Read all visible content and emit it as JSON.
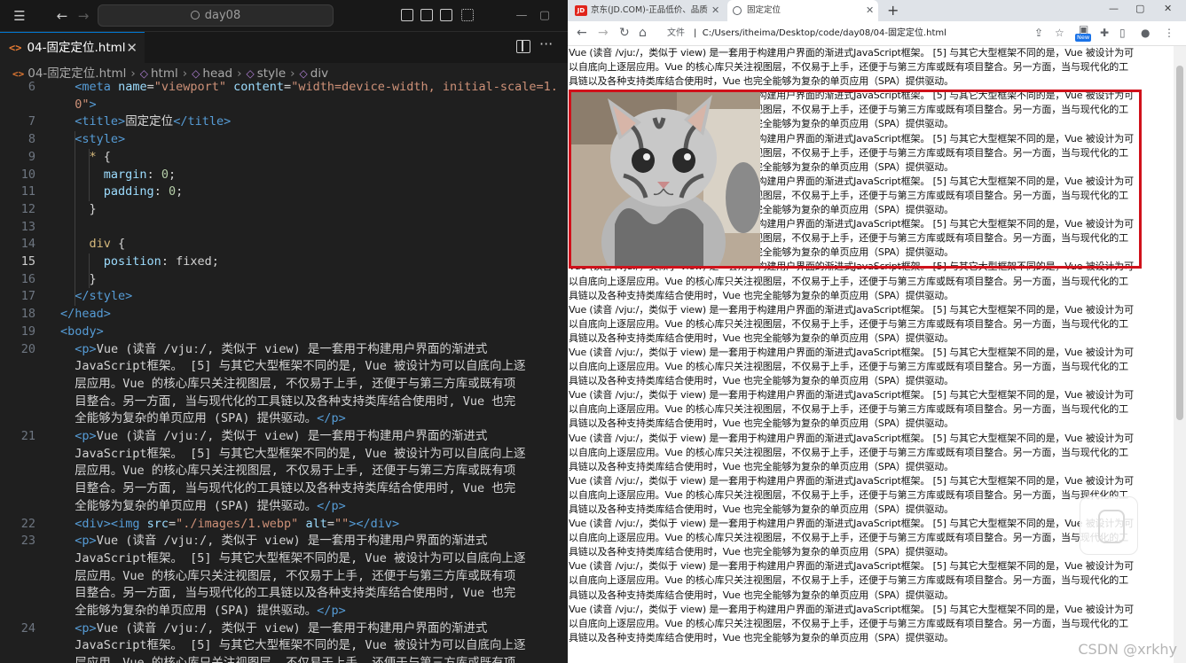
{
  "editor": {
    "search": "day08",
    "tab": {
      "title": "04-固定定位.html",
      "icon": "html-file-icon"
    },
    "breadcrumb": [
      "04-固定定位.html",
      "html",
      "head",
      "style",
      "div"
    ],
    "code_lines": [
      {
        "n": "6",
        "html": "  <span class=\"tag\">&lt;</span><span class=\"tagname\">meta</span> <span class=\"attr\">name</span>=<span class=\"str\">\"viewport\"</span> <span class=\"attr\">content</span>=<span class=\"str\">\"width=device-width, initial-scale=1.</span>"
      },
      {
        "n": "",
        "html": "  <span class=\"str\">0\"</span><span class=\"tag\">&gt;</span>"
      },
      {
        "n": "7",
        "html": "  <span class=\"tag\">&lt;</span><span class=\"tagname\">title</span><span class=\"tag\">&gt;</span><span class=\"txt\">固定定位</span><span class=\"tag\">&lt;/</span><span class=\"tagname\">title</span><span class=\"tag\">&gt;</span>"
      },
      {
        "n": "8",
        "html": "  <span class=\"tag\">&lt;</span><span class=\"tagname\">style</span><span class=\"tag\">&gt;</span>"
      },
      {
        "n": "9",
        "html": "    <span class=\"sel\">*</span> <span class=\"txt\">{</span>"
      },
      {
        "n": "10",
        "html": "      <span class=\"prop\">margin</span><span class=\"txt\">:</span> <span class=\"num\">0</span><span class=\"txt\">;</span>"
      },
      {
        "n": "11",
        "html": "      <span class=\"prop\">padding</span><span class=\"txt\">:</span> <span class=\"num\">0</span><span class=\"txt\">;</span>"
      },
      {
        "n": "12",
        "html": "    <span class=\"txt\">}</span>"
      },
      {
        "n": "13",
        "html": ""
      },
      {
        "n": "14",
        "html": "    <span class=\"sel\">div</span> <span class=\"txt\">{</span>"
      },
      {
        "n": "15",
        "html": "      <span class=\"prop\">position</span><span class=\"txt\">:</span> <span class=\"txt\">fixed;</span>",
        "active": true
      },
      {
        "n": "16",
        "html": "    <span class=\"txt\">}</span>"
      },
      {
        "n": "17",
        "html": "  <span class=\"tag\">&lt;/</span><span class=\"tagname\">style</span><span class=\"tag\">&gt;</span>"
      },
      {
        "n": "18",
        "html": "<span class=\"tag\">&lt;/</span><span class=\"tagname\">head</span><span class=\"tag\">&gt;</span>"
      },
      {
        "n": "19",
        "html": "<span class=\"tag\">&lt;</span><span class=\"tagname\">body</span><span class=\"tag\">&gt;</span>"
      },
      {
        "n": "20",
        "html": "  <span class=\"tag\">&lt;</span><span class=\"tagname\">p</span><span class=\"tag\">&gt;</span><span class=\"txt\">Vue (读音 /vjuː/, 类似于 view) 是一套用于构建用户界面的渐进式</span>"
      },
      {
        "n": "",
        "html": "  <span class=\"txt\">JavaScript框架。 [5] 与其它大型框架不同的是, Vue 被设计为可以自底向上逐</span>"
      },
      {
        "n": "",
        "html": "  <span class=\"txt\">层应用。Vue 的核心库只关注视图层, 不仅易于上手, 还便于与第三方库或既有项</span>"
      },
      {
        "n": "",
        "html": "  <span class=\"txt\">目整合。另一方面, 当与现代化的工具链以及各种支持类库结合使用时, Vue 也完</span>"
      },
      {
        "n": "",
        "html": "  <span class=\"txt\">全能够为复杂的单页应用 (SPA) 提供驱动。</span><span class=\"tag\">&lt;/</span><span class=\"tagname\">p</span><span class=\"tag\">&gt;</span>"
      },
      {
        "n": "21",
        "html": "  <span class=\"tag\">&lt;</span><span class=\"tagname\">p</span><span class=\"tag\">&gt;</span><span class=\"txt\">Vue (读音 /vjuː/, 类似于 view) 是一套用于构建用户界面的渐进式</span>"
      },
      {
        "n": "",
        "html": "  <span class=\"txt\">JavaScript框架。 [5] 与其它大型框架不同的是, Vue 被设计为可以自底向上逐</span>"
      },
      {
        "n": "",
        "html": "  <span class=\"txt\">层应用。Vue 的核心库只关注视图层, 不仅易于上手, 还便于与第三方库或既有项</span>"
      },
      {
        "n": "",
        "html": "  <span class=\"txt\">目整合。另一方面, 当与现代化的工具链以及各种支持类库结合使用时, Vue 也完</span>"
      },
      {
        "n": "",
        "html": "  <span class=\"txt\">全能够为复杂的单页应用 (SPA) 提供驱动。</span><span class=\"tag\">&lt;/</span><span class=\"tagname\">p</span><span class=\"tag\">&gt;</span>"
      },
      {
        "n": "22",
        "html": "  <span class=\"tag\">&lt;</span><span class=\"tagname\">div</span><span class=\"tag\">&gt;&lt;</span><span class=\"tagname\">img</span> <span class=\"attr\">src</span>=<span class=\"str\">\"./images/1.webp\"</span> <span class=\"attr\">alt</span>=<span class=\"str\">\"\"</span><span class=\"tag\">&gt;&lt;/</span><span class=\"tagname\">div</span><span class=\"tag\">&gt;</span>"
      },
      {
        "n": "23",
        "html": "  <span class=\"tag\">&lt;</span><span class=\"tagname\">p</span><span class=\"tag\">&gt;</span><span class=\"txt\">Vue (读音 /vjuː/, 类似于 view) 是一套用于构建用户界面的渐进式</span>"
      },
      {
        "n": "",
        "html": "  <span class=\"txt\">JavaScript框架。 [5] 与其它大型框架不同的是, Vue 被设计为可以自底向上逐</span>"
      },
      {
        "n": "",
        "html": "  <span class=\"txt\">层应用。Vue 的核心库只关注视图层, 不仅易于上手, 还便于与第三方库或既有项</span>"
      },
      {
        "n": "",
        "html": "  <span class=\"txt\">目整合。另一方面, 当与现代化的工具链以及各种支持类库结合使用时, Vue 也完</span>"
      },
      {
        "n": "",
        "html": "  <span class=\"txt\">全能够为复杂的单页应用 (SPA) 提供驱动。</span><span class=\"tag\">&lt;/</span><span class=\"tagname\">p</span><span class=\"tag\">&gt;</span>"
      },
      {
        "n": "24",
        "html": "  <span class=\"tag\">&lt;</span><span class=\"tagname\">p</span><span class=\"tag\">&gt;</span><span class=\"txt\">Vue (读音 /vjuː/, 类似于 view) 是一套用于构建用户界面的渐进式</span>"
      },
      {
        "n": "",
        "html": "  <span class=\"txt\">JavaScript框架。 [5] 与其它大型框架不同的是, Vue 被设计为可以自底向上逐</span>"
      },
      {
        "n": "",
        "html": "  <span class=\"txt\">层应用。Vue 的核心库只关注视图层, 不仅易于上手, 还便于与第三方库或既有项</span>"
      }
    ]
  },
  "browser": {
    "tabs": [
      {
        "title": "京东(JD.COM)-正品低价、品质",
        "icon": "jd-logo-icon"
      },
      {
        "title": "固定定位",
        "icon": "globe-icon",
        "active": true
      }
    ],
    "address": {
      "label": "文件",
      "url": "C:/Users/itheima/Desktop/code/day08/04-固定定位.html"
    },
    "new_badge": "New",
    "paragraph_lines": [
      "Vue (读音 /vjuː/，类似于 view) 是一套用于构建用户界面的渐进式JavaScript框架。 [5] 与其它大型框架不同的是，Vue 被设计为可",
      "以自底向上逐层应用。Vue 的核心库只关注视图层，不仅易于上手，还便于与第三方库或既有项目整合。另一方面，当与现代化的工",
      "具链以及各种支持类库结合使用时，Vue 也完全能够为复杂的单页应用（SPA）提供驱动。"
    ],
    "paragraph_repeat": 14
  },
  "watermark": "CSDN @xrkhy",
  "colors": {
    "fixed_border": "#d0111a",
    "editor_bg": "#1f1f1f",
    "accent": "#0078d4"
  }
}
